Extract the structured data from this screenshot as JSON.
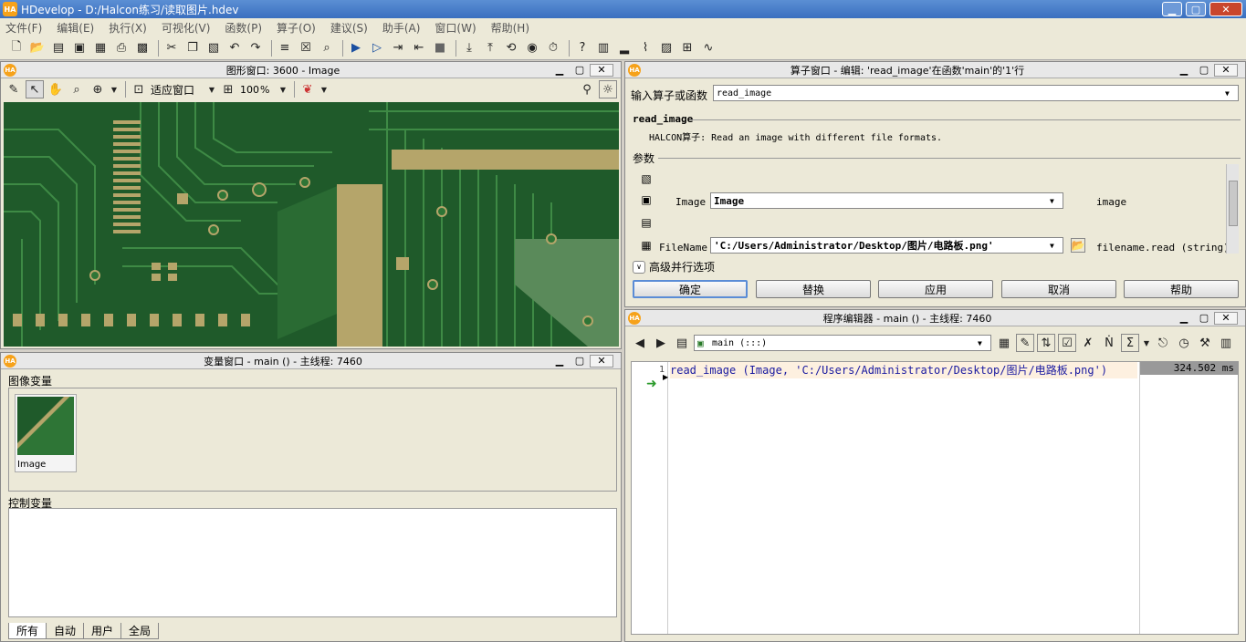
{
  "window": {
    "title": "HDevelop - D:/Halcon练习/读取图片.hdev",
    "logo": "HA",
    "min": "▁",
    "max": "▢",
    "close": "✕"
  },
  "menu": [
    "文件(F)",
    "编辑(E)",
    "执行(X)",
    "可视化(V)",
    "函数(P)",
    "算子(O)",
    "建议(S)",
    "助手(A)",
    "窗口(W)",
    "帮助(H)"
  ],
  "toolbar_icons": [
    "new-file-icon",
    "open-file-icon",
    "browse-icon",
    "save-icon",
    "save-all-icon",
    "print-icon",
    "cut-icon",
    "copy-icon",
    "paste-icon",
    "undo-icon",
    "redo-icon",
    "insert-icon",
    "delete-icon",
    "search-icon",
    "run-icon",
    "step-icon",
    "step-over-icon",
    "step-back-icon",
    "stop-icon",
    "step-into-icon",
    "step-out-icon",
    "reset-icon",
    "watch-icon",
    "timer-icon",
    "help-icon",
    "graph-icon",
    "histogram-icon",
    "line-profile-icon",
    "gray-icon",
    "feature-icon"
  ],
  "graphics": {
    "title": "图形窗口: 3600 - Image",
    "fit_label": "适应窗口",
    "zoom_value": "100",
    "zoom_unit": "%"
  },
  "variables": {
    "title": "变量窗口 - main () - 主线程: 7460",
    "image_group": "图像变量",
    "image_var": "Image",
    "control_group": "控制变量",
    "tabs": [
      "所有",
      "自动",
      "用户",
      "全局"
    ]
  },
  "operator": {
    "title": "算子窗口 - 编辑: 'read_image'在函数'main'的'1'行",
    "input_label": "输入算子或函数",
    "input_value": "read_image",
    "name": "read_image",
    "desc": "HALCON算子: Read an image with different file formats.",
    "params_label": "参数",
    "p1_name": "Image",
    "p1_value": "Image",
    "p1_type": "image",
    "p2_name": "FileName",
    "p2_value": "'C:/Users/Administrator/Desktop/图片/电路板.png'",
    "p2_type": "filename.read (string)",
    "advanced": "高级并行选项",
    "buttons": [
      "确定",
      "替换",
      "应用",
      "取消",
      "帮助"
    ]
  },
  "editor": {
    "title": "程序编辑器 - main () - 主线程: 7460",
    "proc": "main (:::)",
    "line_no": "1",
    "code_op": "read_image",
    "code_args": " (Image, ",
    "code_str": "'C:/Users/Administrator/Desktop/图片/电路板.png'",
    "code_end": ")",
    "time": "324.502 ms"
  },
  "colors": {
    "pcb_base": "#1f5a2a",
    "pcb_trace": "#3e8a45",
    "pad": "#b5a56a",
    "accent": "#5a8cd6"
  }
}
